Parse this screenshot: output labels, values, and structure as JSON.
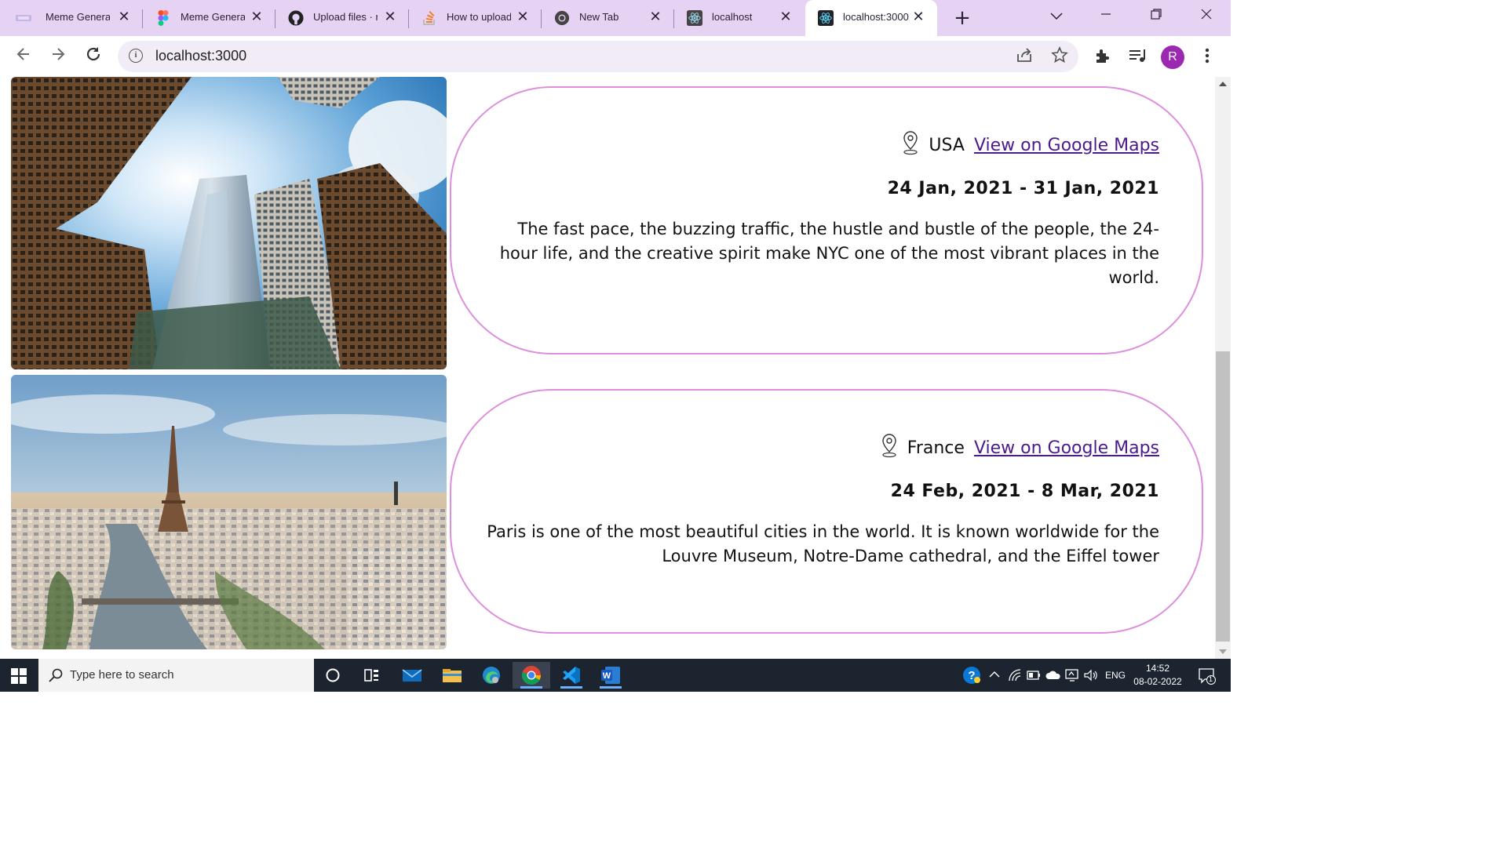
{
  "browser": {
    "tabs": [
      {
        "title": "Meme Generator",
        "icon": "meme-generator-favicon",
        "active": false
      },
      {
        "title": "Meme Generator",
        "icon": "figma-icon",
        "active": false
      },
      {
        "title": "Upload files · roushanks",
        "icon": "github-icon",
        "active": false
      },
      {
        "title": "How to upload",
        "icon": "stackoverflow-icon",
        "active": false
      },
      {
        "title": "New Tab",
        "icon": "chrome-icon",
        "active": false
      },
      {
        "title": "localhost",
        "icon": "react-icon",
        "active": false
      },
      {
        "title": "localhost:3000",
        "icon": "react-icon",
        "active": true
      }
    ],
    "new_tab_symbol": "+",
    "url": "localhost:3000",
    "avatar_letter": "R"
  },
  "page": {
    "entries": [
      {
        "photo": "new-york-skyscrapers-photo",
        "country": "USA",
        "map_link": "View on Google Maps",
        "dates": "24 Jan, 2021 - 31 Jan, 2021",
        "description": "The fast pace, the buzzing traffic, the hustle and bustle of the people, the 24-hour life, and the creative spirit make NYC one of the most vibrant places in the world."
      },
      {
        "photo": "paris-eiffel-tower-photo",
        "country": "France",
        "map_link": "View on Google Maps",
        "dates": "24 Feb, 2021 - 8 Mar, 2021",
        "description": "Paris is one of the most beautiful cities in the world. It is known worldwide for the Louvre Museum, Notre-Dame cathedral, and the Eiffel tower"
      }
    ],
    "card_border_color": "#dd8fdd",
    "link_color": "#4b1a8c"
  },
  "taskbar": {
    "search_placeholder": "Type here to search",
    "language": "ENG",
    "time": "14:52",
    "date": "08-02-2022",
    "notification_count": "1"
  }
}
